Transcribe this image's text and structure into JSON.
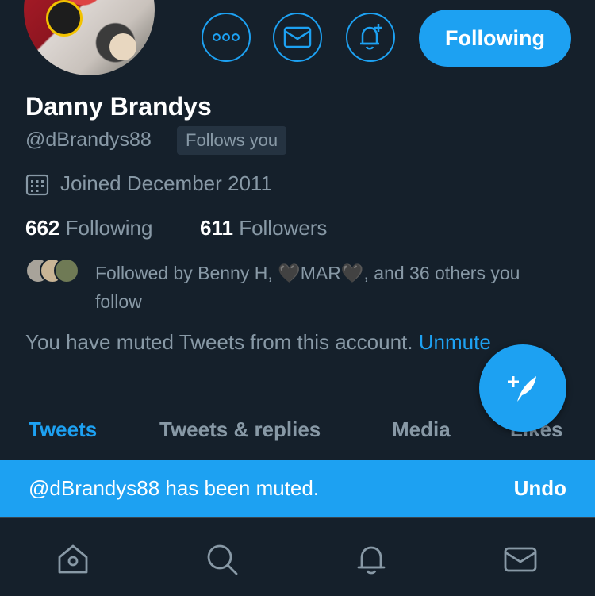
{
  "profile": {
    "name": "Danny Brandys",
    "handle": "@dBrandys88",
    "follows_you": "Follows you",
    "joined": "Joined December 2011",
    "following_count": "662",
    "following_label": "Following",
    "followers_count": "611",
    "followers_label": "Followers",
    "followed_by": "Followed by Benny H, 🖤MAR🖤, and 36 others you follow",
    "muted_notice": "You have muted Tweets from this account.",
    "unmute_label": "Unmute"
  },
  "actions": {
    "following_button": "Following",
    "more_icon": "more-icon",
    "message_icon": "envelope-icon",
    "notify_icon": "bell-plus-icon"
  },
  "tabs": [
    {
      "label": "Tweets",
      "active": true
    },
    {
      "label": "Tweets & replies",
      "active": false
    },
    {
      "label": "Media",
      "active": false
    },
    {
      "label": "Likes",
      "active": false
    }
  ],
  "toast": {
    "message": "@dBrandys88 has been muted.",
    "undo": "Undo"
  },
  "nav": [
    "home-icon",
    "search-icon",
    "notifications-icon",
    "messages-icon"
  ],
  "colors": {
    "background": "#15202b",
    "accent": "#1da1f2",
    "secondary_text": "#8899a6"
  }
}
